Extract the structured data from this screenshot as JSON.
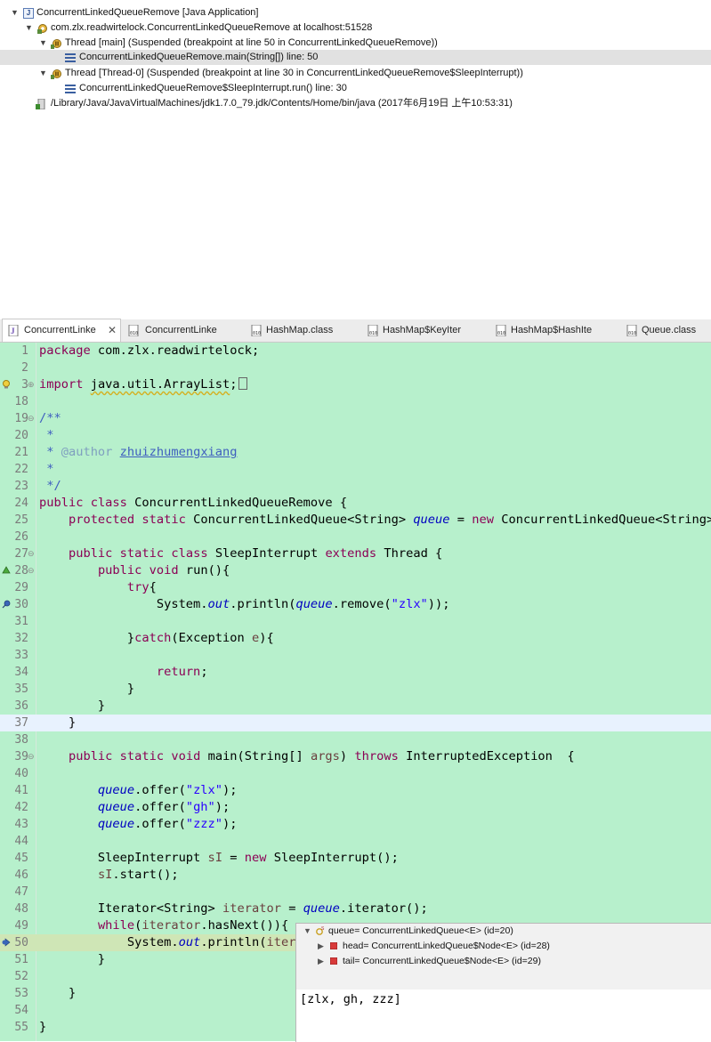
{
  "debug_tree": {
    "rows": [
      {
        "label": "ConcurrentLinkedQueueRemove [Java Application]",
        "icon": "java-application-icon",
        "expanded": true
      },
      {
        "label": "com.zlx.readwirtelock.ConcurrentLinkedQueueRemove at localhost:51528",
        "icon": "debug-target-icon",
        "expanded": true
      },
      {
        "label": "Thread [main] (Suspended (breakpoint at line 50 in ConcurrentLinkedQueueRemove))",
        "icon": "suspended-thread-icon",
        "expanded": true
      },
      {
        "label": "ConcurrentLinkedQueueRemove.main(String[]) line: 50",
        "icon": "stack-frame-icon",
        "selected": true
      },
      {
        "label": "Thread [Thread-0] (Suspended (breakpoint at line 30 in ConcurrentLinkedQueueRemove$SleepInterrupt))",
        "icon": "suspended-thread-icon",
        "expanded": true
      },
      {
        "label": "ConcurrentLinkedQueueRemove$SleepInterrupt.run() line: 30",
        "icon": "stack-frame-icon"
      },
      {
        "label": "/Library/Java/JavaVirtualMachines/jdk1.7.0_79.jdk/Contents/Home/bin/java (2017年6月19日 上午10:53:31)",
        "icon": "jvm-process-icon"
      }
    ]
  },
  "tabs": [
    {
      "label": "ConcurrentLinke",
      "icon": "java-source-icon",
      "active": true,
      "close": "✕"
    },
    {
      "label": "ConcurrentLinke",
      "icon": "class-file-icon"
    },
    {
      "label": "HashMap.class",
      "icon": "class-file-icon"
    },
    {
      "label": "HashMap$KeyIter",
      "icon": "class-file-icon"
    },
    {
      "label": "HashMap$HashIte",
      "icon": "class-file-icon"
    },
    {
      "label": "Queue.class",
      "icon": "class-file-icon"
    }
  ],
  "editor": {
    "line_numbers": [
      "1",
      "2",
      "3",
      "18",
      "19",
      "20",
      "21",
      "22",
      "23",
      "24",
      "25",
      "26",
      "27",
      "28",
      "29",
      "30",
      "31",
      "32",
      "33",
      "34",
      "35",
      "36",
      "37",
      "38",
      "39",
      "40",
      "41",
      "42",
      "43",
      "44",
      "45",
      "46",
      "47",
      "48",
      "49",
      "50",
      "51",
      "52",
      "53",
      "54",
      "55"
    ],
    "current_line": "37",
    "debug_line": "50",
    "tokens": {
      "l1": [
        "package",
        " com.zlx.readwirtelock;"
      ],
      "l3": [
        "import",
        " ",
        "java.util.ArrayList",
        ";"
      ],
      "l19": "/**",
      "l20": " *",
      "l21": [
        " * ",
        "@author",
        " ",
        "zhuizhumengxiang"
      ],
      "l22": " *",
      "l23": " */",
      "l24": [
        "public",
        " ",
        "class",
        " ConcurrentLinkedQueueRemove {"
      ],
      "l25": [
        "    ",
        "protected",
        " ",
        "static",
        " ConcurrentLinkedQueue<String> ",
        "queue",
        " = ",
        "new",
        " ConcurrentLinkedQueue<String>()"
      ],
      "l27": [
        "    ",
        "public",
        " ",
        "static",
        " ",
        "class",
        " SleepInterrupt ",
        "extends",
        " Thread {"
      ],
      "l28": [
        "        ",
        "public",
        " ",
        "void",
        " run(){"
      ],
      "l29": [
        "            ",
        "try",
        "{"
      ],
      "l30": [
        "                System.",
        "out",
        ".println(",
        "queue",
        ".remove(",
        "\"zlx\"",
        "));"
      ],
      "l32": [
        "            }",
        "catch",
        "(Exception ",
        "e",
        "){"
      ],
      "l34": [
        "                ",
        "return",
        ";"
      ],
      "l35": "            }",
      "l36": "        }",
      "l37": "    }",
      "l39": [
        "    ",
        "public",
        " ",
        "static",
        " ",
        "void",
        " main(String[] ",
        "args",
        ") ",
        "throws",
        " InterruptedException  {"
      ],
      "l41": [
        "        ",
        "queue",
        ".offer(",
        "\"zlx\"",
        ");"
      ],
      "l42": [
        "        ",
        "queue",
        ".offer(",
        "\"gh\"",
        ");"
      ],
      "l43": [
        "        ",
        "queue",
        ".offer(",
        "\"zzz\"",
        ");"
      ],
      "l45": [
        "        SleepInterrupt ",
        "sI",
        " = ",
        "new",
        " SleepInterrupt();"
      ],
      "l46": [
        "        ",
        "sI",
        ".start();"
      ],
      "l48": [
        "        Iterator<String> ",
        "iterator",
        " = ",
        "queue",
        ".iterator();"
      ],
      "l49": [
        "        ",
        "while",
        "(",
        "iterator",
        ".hasNext()){"
      ],
      "l50": [
        "            System.",
        "out",
        ".println(",
        "itera"
      ],
      "l51": "        }",
      "l53": "    }",
      "l55": "}"
    }
  },
  "hover_popup": {
    "root": "queue= ConcurrentLinkedQueue<E>  (id=20)",
    "children": [
      {
        "label": "head= ConcurrentLinkedQueue$Node<E>  (id=28)"
      },
      {
        "label": "tail= ConcurrentLinkedQueue$Node<E>  (id=29)"
      }
    ],
    "detail": "[zlx, gh, zzz]"
  },
  "colors": {
    "editor_bg": "#b7f0cc",
    "current_line_bg": "#e8f2fe",
    "debug_line_bg": "#cfe6b6",
    "keyword": "#8b0055",
    "comment": "#3f5fbf",
    "field": "#0000c0",
    "string": "#2a00ff"
  }
}
